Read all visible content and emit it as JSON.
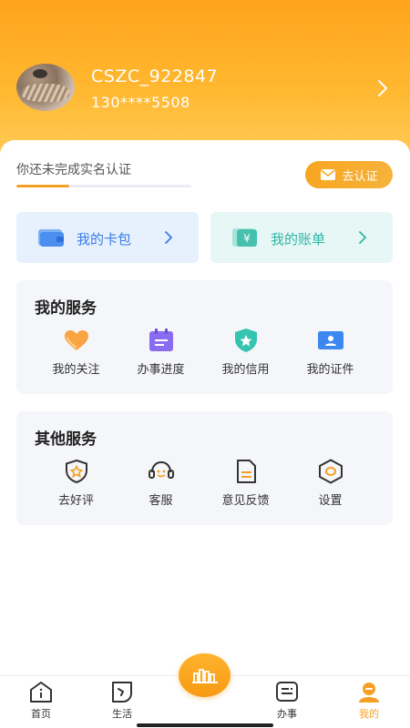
{
  "profile": {
    "username": "CSZC_922847",
    "phone": "130****5508"
  },
  "verification": {
    "prompt": "你还未完成实名认证",
    "progress_fraction": 0.3,
    "button_label": "去认证"
  },
  "cards": [
    {
      "label": "我的卡包",
      "icon": "wallet-icon"
    },
    {
      "label": "我的账单",
      "icon": "yuan-bill-icon"
    }
  ],
  "my_services": {
    "title": "我的服务",
    "items": [
      {
        "label": "我的关注",
        "icon": "heart-icon"
      },
      {
        "label": "办事进度",
        "icon": "calendar-progress-icon"
      },
      {
        "label": "我的信用",
        "icon": "shield-star-icon"
      },
      {
        "label": "我的证件",
        "icon": "id-card-icon"
      }
    ]
  },
  "other_services": {
    "title": "其他服务",
    "items": [
      {
        "label": "去好评",
        "icon": "shield-star-outline-icon"
      },
      {
        "label": "客服",
        "icon": "headset-icon"
      },
      {
        "label": "意见反馈",
        "icon": "document-icon"
      },
      {
        "label": "设置",
        "icon": "hexagon-settings-icon"
      }
    ]
  },
  "tabbar": {
    "items": [
      {
        "label": "首页",
        "icon": "home-icon"
      },
      {
        "label": "生活",
        "icon": "life-icon"
      },
      {
        "label": "办事",
        "icon": "affairs-icon"
      },
      {
        "label": "我的",
        "icon": "profile-icon",
        "active": true
      }
    ],
    "center_icon": "city-skyline-icon"
  },
  "colors": {
    "accent": "#f5a024",
    "wallet_blue": "#3a7de8",
    "bill_teal": "#2fb7a8"
  }
}
